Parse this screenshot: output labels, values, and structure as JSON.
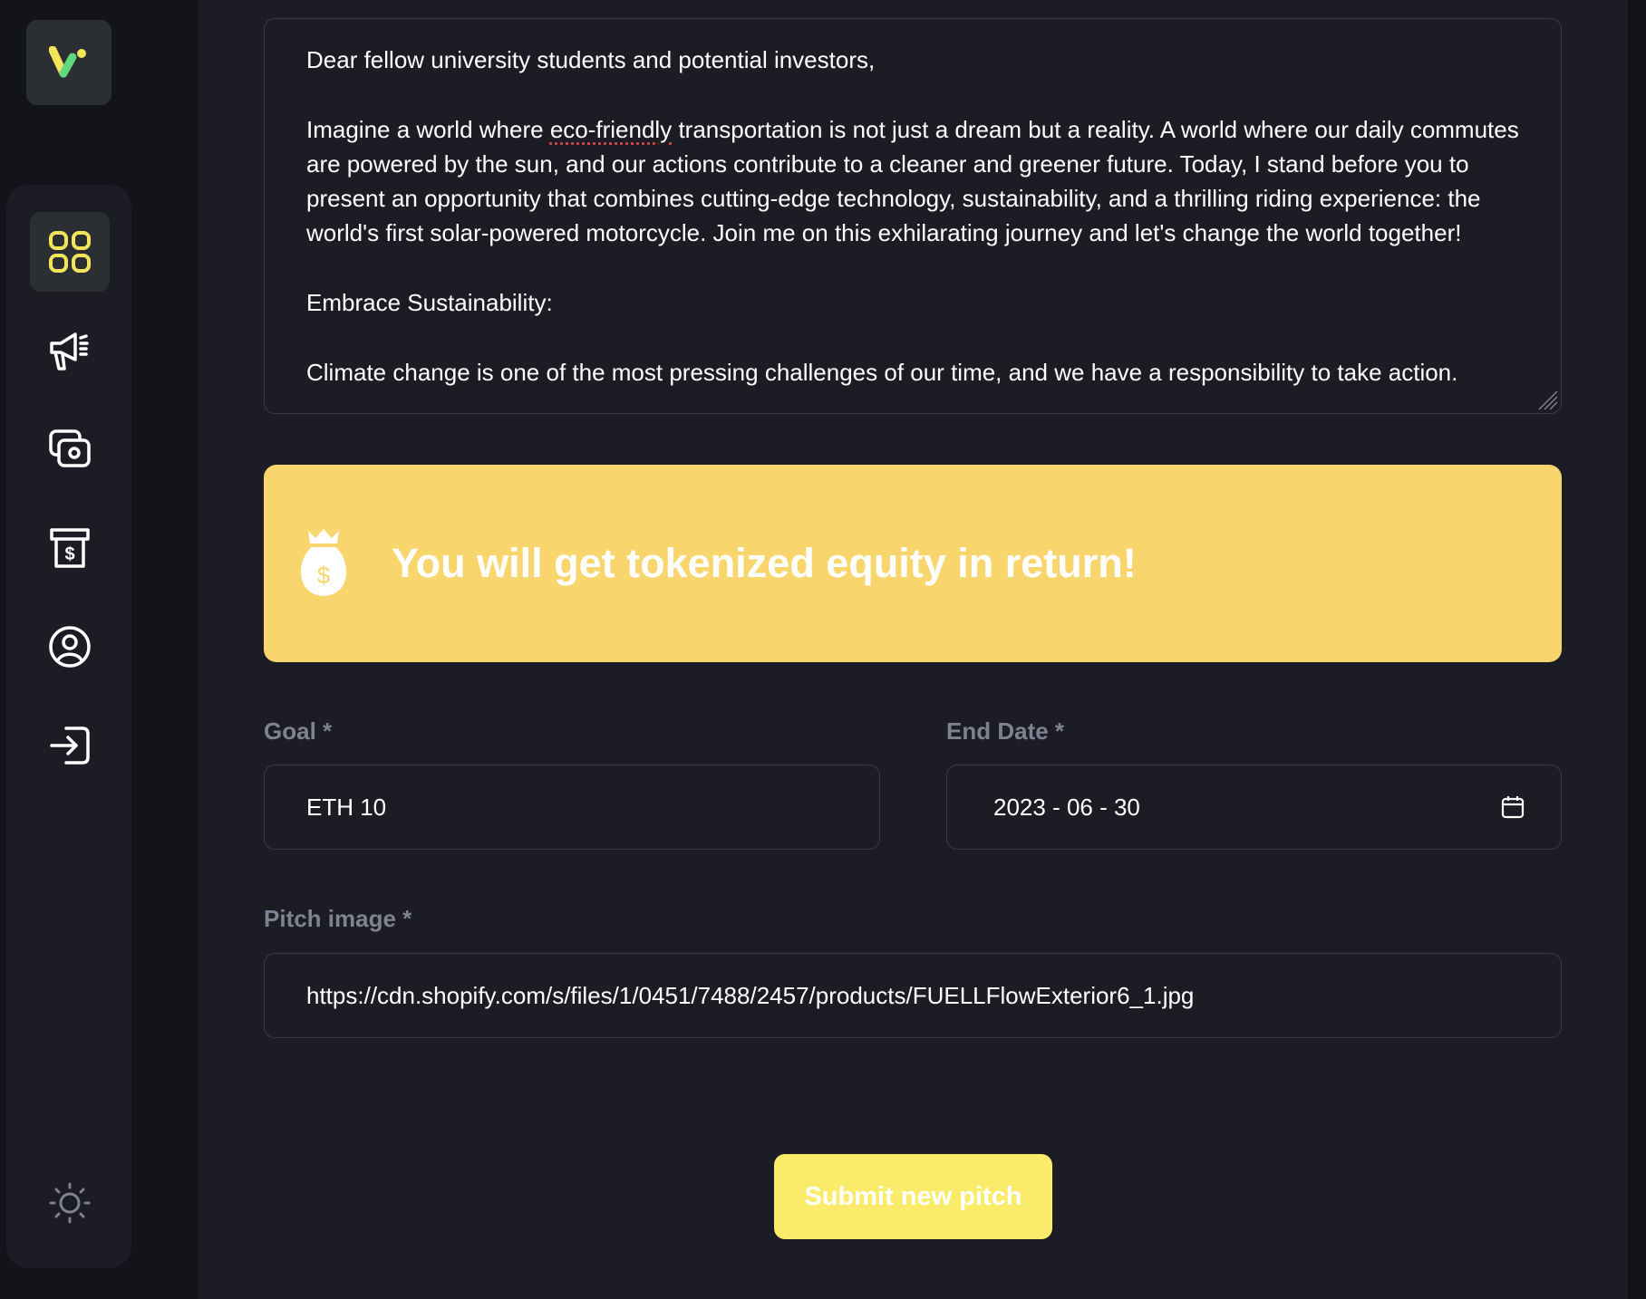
{
  "sidebar": {
    "logo_icon": "app-logo-icon",
    "nav_items": [
      {
        "icon": "dashboard-icon",
        "active": true
      },
      {
        "icon": "campaign-megaphone-icon",
        "active": false
      },
      {
        "icon": "payment-icon",
        "active": false
      },
      {
        "icon": "withdraw-icon",
        "active": false
      },
      {
        "icon": "profile-icon",
        "active": false
      },
      {
        "icon": "logout-icon",
        "active": false
      }
    ],
    "theme_toggle_icon": "sun-icon"
  },
  "story": {
    "paragraphs": [
      "Dear fellow university students and potential investors,",
      "",
      "Imagine a world where eco-friendly transportation is not just a dream but a reality. A world where our daily commutes are powered by the sun, and our actions contribute to a cleaner and greener future. Today, I stand before you to present an opportunity that combines cutting-edge technology, sustainability, and a thrilling riding experience: the world's first solar-powered motorcycle. Join me on this exhilarating journey and let's change the world together!",
      "",
      "Embrace Sustainability:",
      "",
      "Climate change is one of the most pressing challenges of our time, and we have a responsibility to take action."
    ]
  },
  "banner": {
    "icon": "money-bag-icon",
    "text": "You will get tokenized equity in return!"
  },
  "form": {
    "goal_label": "Goal *",
    "goal_value": "ETH 10",
    "end_date_label": "End Date *",
    "end_date_value": "2023 - 06 - 30",
    "pitch_image_label": "Pitch image *",
    "pitch_image_value": "https://cdn.shopify.com/s/files/1/0451/7488/2457/products/FUELLFlowExterior6_1.jpg"
  },
  "submit_label": "Submit new pitch",
  "colors": {
    "accent": "#faeb6a",
    "banner": "#f8d66d",
    "background": "#1c1c24",
    "sidebar": "#13131a",
    "label": "#808191"
  }
}
